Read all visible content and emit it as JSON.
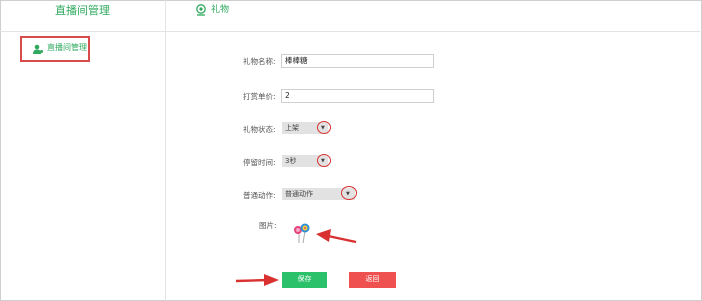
{
  "sidebar": {
    "title": "直播间管理",
    "items": [
      {
        "label": "直播间管理",
        "icon": "user-icon"
      }
    ]
  },
  "header": {
    "tab_label": "礼物",
    "tab_icon": "gift-icon"
  },
  "form": {
    "name_label": "礼物名称:",
    "name_value": "棒棒糖",
    "price_label": "打赏单价:",
    "price_value": "2",
    "status_label": "礼物状态:",
    "status_value": "上架",
    "duration_label": "停留时间:",
    "duration_value": "3秒",
    "action_label": "普通动作:",
    "action_value": "普通动作",
    "image_label": "图片:"
  },
  "buttons": {
    "save": "保存",
    "back": "返回"
  },
  "colors": {
    "accent_green": "#2ea95e",
    "save_green": "#2bc06a",
    "back_red": "#ef5150",
    "annotation_red": "#d93030"
  }
}
